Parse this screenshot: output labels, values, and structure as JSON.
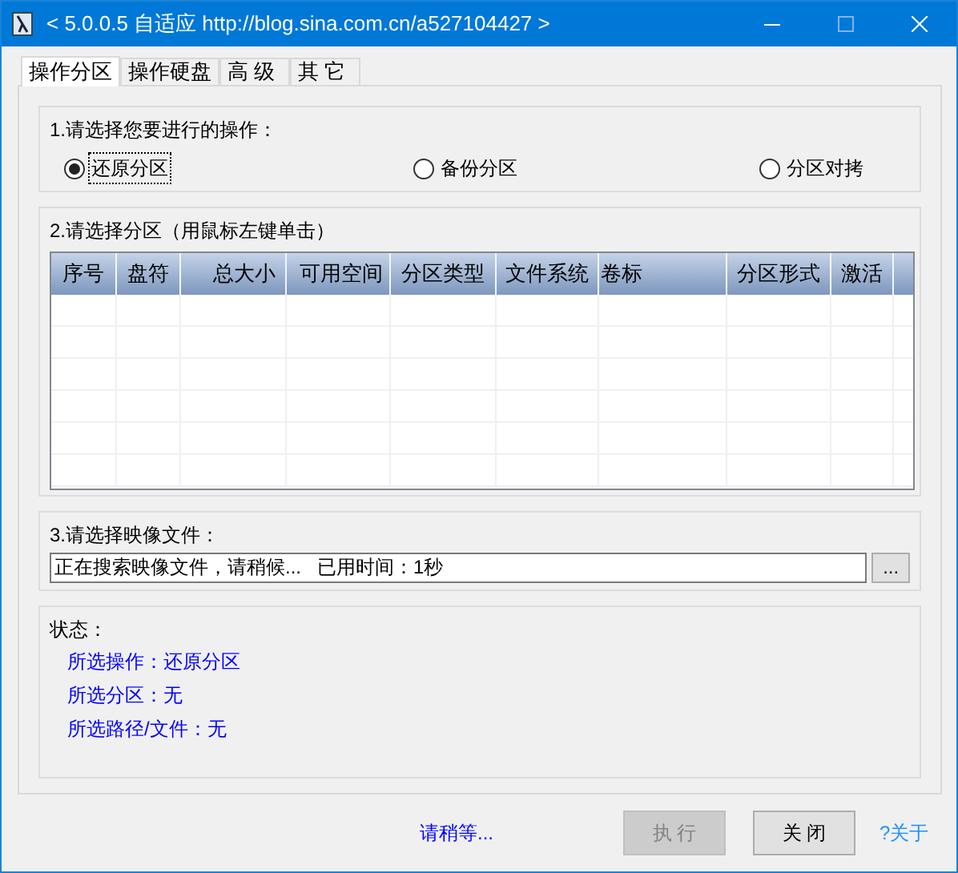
{
  "window": {
    "title": "< 5.0.0.5 自适应 http://blog.sina.com.cn/a527104427 >"
  },
  "tabs": [
    {
      "label": "操作分区",
      "selected": true
    },
    {
      "label": "操作硬盘",
      "selected": false
    },
    {
      "label": "高 级",
      "selected": false
    },
    {
      "label": "其 它",
      "selected": false
    }
  ],
  "operation_group": {
    "label": "1.请选择您要进行的操作：",
    "options": [
      {
        "label": "还原分区",
        "selected": true
      },
      {
        "label": "备份分区",
        "selected": false
      },
      {
        "label": "分区对拷",
        "selected": false
      }
    ]
  },
  "partition_group": {
    "label": "2.请选择分区（用鼠标左键单击）",
    "table": {
      "columns": [
        "序号",
        "盘符",
        "总大小",
        "可用空间",
        "分区类型",
        "文件系统",
        "卷标",
        "分区形式",
        "激活"
      ]
    }
  },
  "image_group": {
    "label": "3.请选择映像文件：",
    "value": "正在搜索映像文件，请稍候...   已用时间：1秒",
    "browse_button": "..."
  },
  "status_group": {
    "label": "状态：",
    "lines": [
      "所选操作：还原分区",
      "所选分区：无",
      "所选路径/文件：无"
    ]
  },
  "footer": {
    "message": "请稍等...",
    "buttons": [
      {
        "label": "执 行",
        "disabled": true
      },
      {
        "label": "关 闭",
        "disabled": false
      }
    ],
    "about_link": "?关于"
  }
}
